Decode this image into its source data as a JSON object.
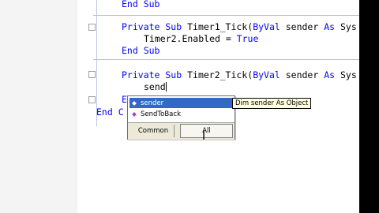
{
  "code": {
    "line1": {
      "kw": "End Sub"
    },
    "line2": {
      "kw1": "Private Sub",
      "t1": " Timer1_Tick(",
      "kw2": "ByVal",
      "t2": " sender ",
      "kw3": "As",
      "t3": " Sys"
    },
    "line3": {
      "t1": "Timer2.Enabled = ",
      "kw": "True"
    },
    "line4": {
      "kw": "End Sub"
    },
    "line5": {
      "kw1": "Private Sub",
      "t1": " Timer2_Tick(",
      "kw2": "ByVal",
      "t2": " sender ",
      "kw3": "As",
      "t3": " Sys"
    },
    "line6": {
      "typed": "send"
    },
    "line7": {
      "kw": "E"
    },
    "line8": {
      "kw": "End C"
    }
  },
  "intellisense": {
    "items": [
      {
        "label": "sender",
        "icon": "variable-icon",
        "selected": true
      },
      {
        "label": "SendToBack",
        "icon": "method-icon",
        "selected": false
      }
    ],
    "tabs": {
      "common": "Common",
      "all": "All"
    }
  },
  "tooltip": "Dim sender As Object",
  "colors": {
    "keyword": "#0000ff",
    "selection": "#316ac5",
    "tooltip_bg": "#ffffe1"
  }
}
